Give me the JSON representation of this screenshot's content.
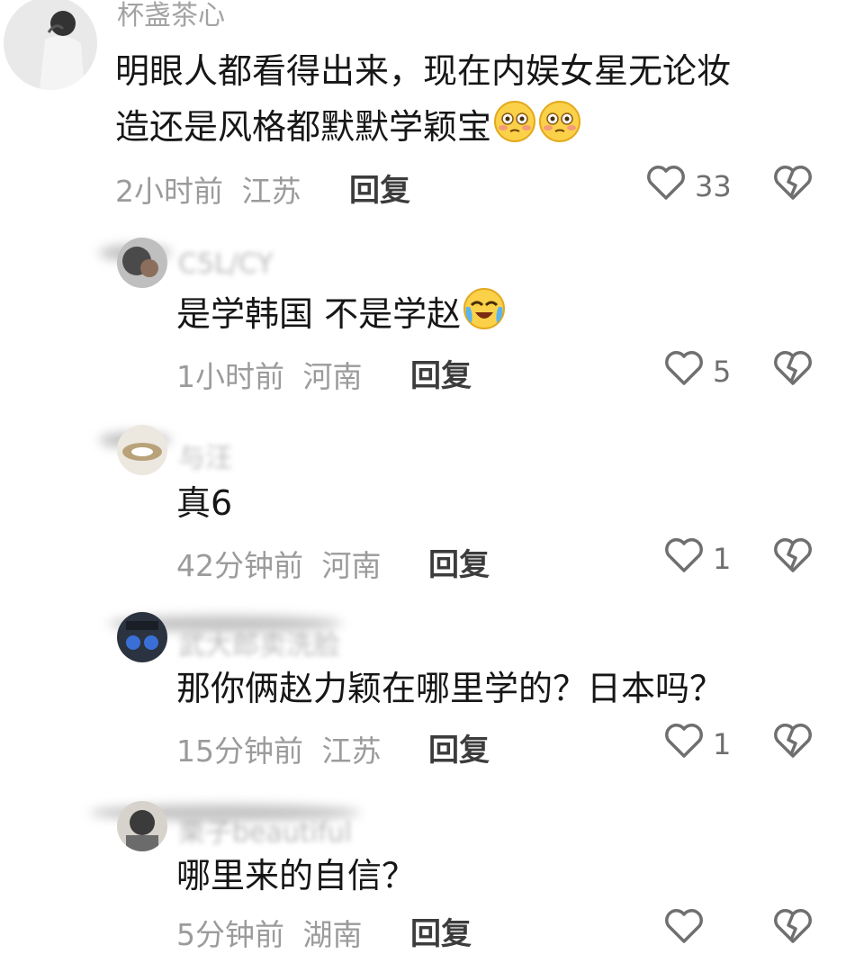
{
  "comments": [
    {
      "username": "杯盏茶心",
      "text_line1": "明眼人都看得出来，现在内娱女星无论妆",
      "text_line2": "造还是风格都默默学颖宝",
      "emoji": [
        "flushed-face",
        "flushed-face"
      ],
      "time": "2小时前",
      "location": "江苏",
      "reply_label": "回复",
      "likes": "33"
    },
    {
      "username": "C5L/CY",
      "text": "是学韩国  不是学赵",
      "emoji": [
        "crying-face"
      ],
      "time": "1小时前",
      "location": "河南",
      "reply_label": "回复",
      "likes": "5"
    },
    {
      "username": "与汪",
      "text": "真6",
      "time": "42分钟前",
      "location": "河南",
      "reply_label": "回复",
      "likes": "1"
    },
    {
      "username": "武大郎卖洗脸",
      "text": "那你俩赵力颖在哪里学的？日本吗？",
      "time": "15分钟前",
      "location": "江苏",
      "reply_label": "回复",
      "likes": "1"
    },
    {
      "username": "栗子beautiful",
      "text": "哪里来的自信？",
      "time": "5分钟前",
      "location": "湖南",
      "reply_label": "回复",
      "likes": ""
    }
  ],
  "icons": {
    "like": "heart-outline-icon",
    "dislike": "broken-heart-icon"
  },
  "colors": {
    "text": "#161616",
    "meta": "#9b9b9b",
    "icon": "#6f6f6f"
  }
}
